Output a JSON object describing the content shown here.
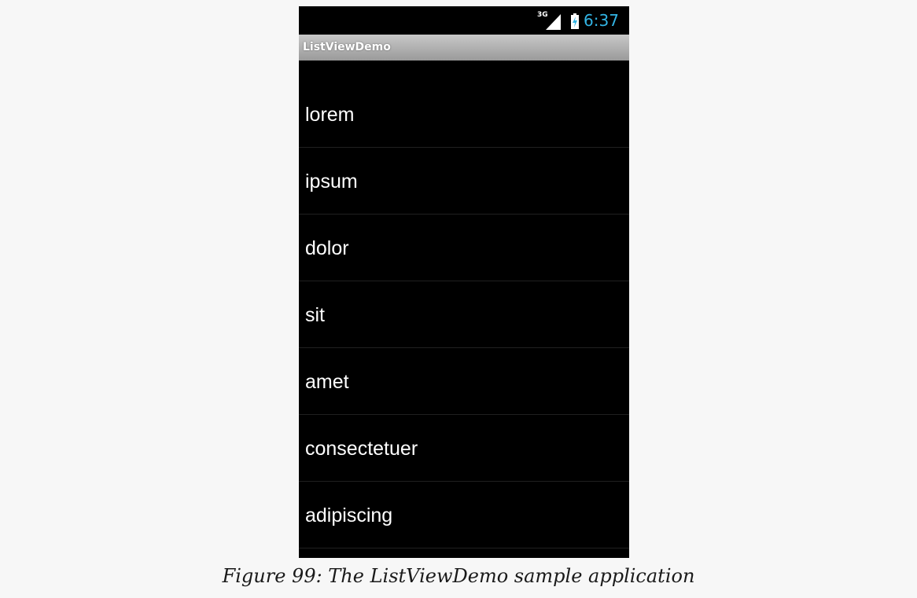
{
  "status_bar": {
    "network_label": "3G",
    "time": "6:37",
    "time_color": "#33b5e5",
    "icons": [
      "signal-icon",
      "battery-charging-icon"
    ]
  },
  "app": {
    "title": "ListViewDemo"
  },
  "list": {
    "items": [
      {
        "label": "lorem"
      },
      {
        "label": "ipsum"
      },
      {
        "label": "dolor"
      },
      {
        "label": "sit"
      },
      {
        "label": "amet"
      },
      {
        "label": "consectetuer"
      },
      {
        "label": "adipiscing"
      }
    ]
  },
  "caption": {
    "text": "Figure 99: The ListViewDemo sample application"
  }
}
